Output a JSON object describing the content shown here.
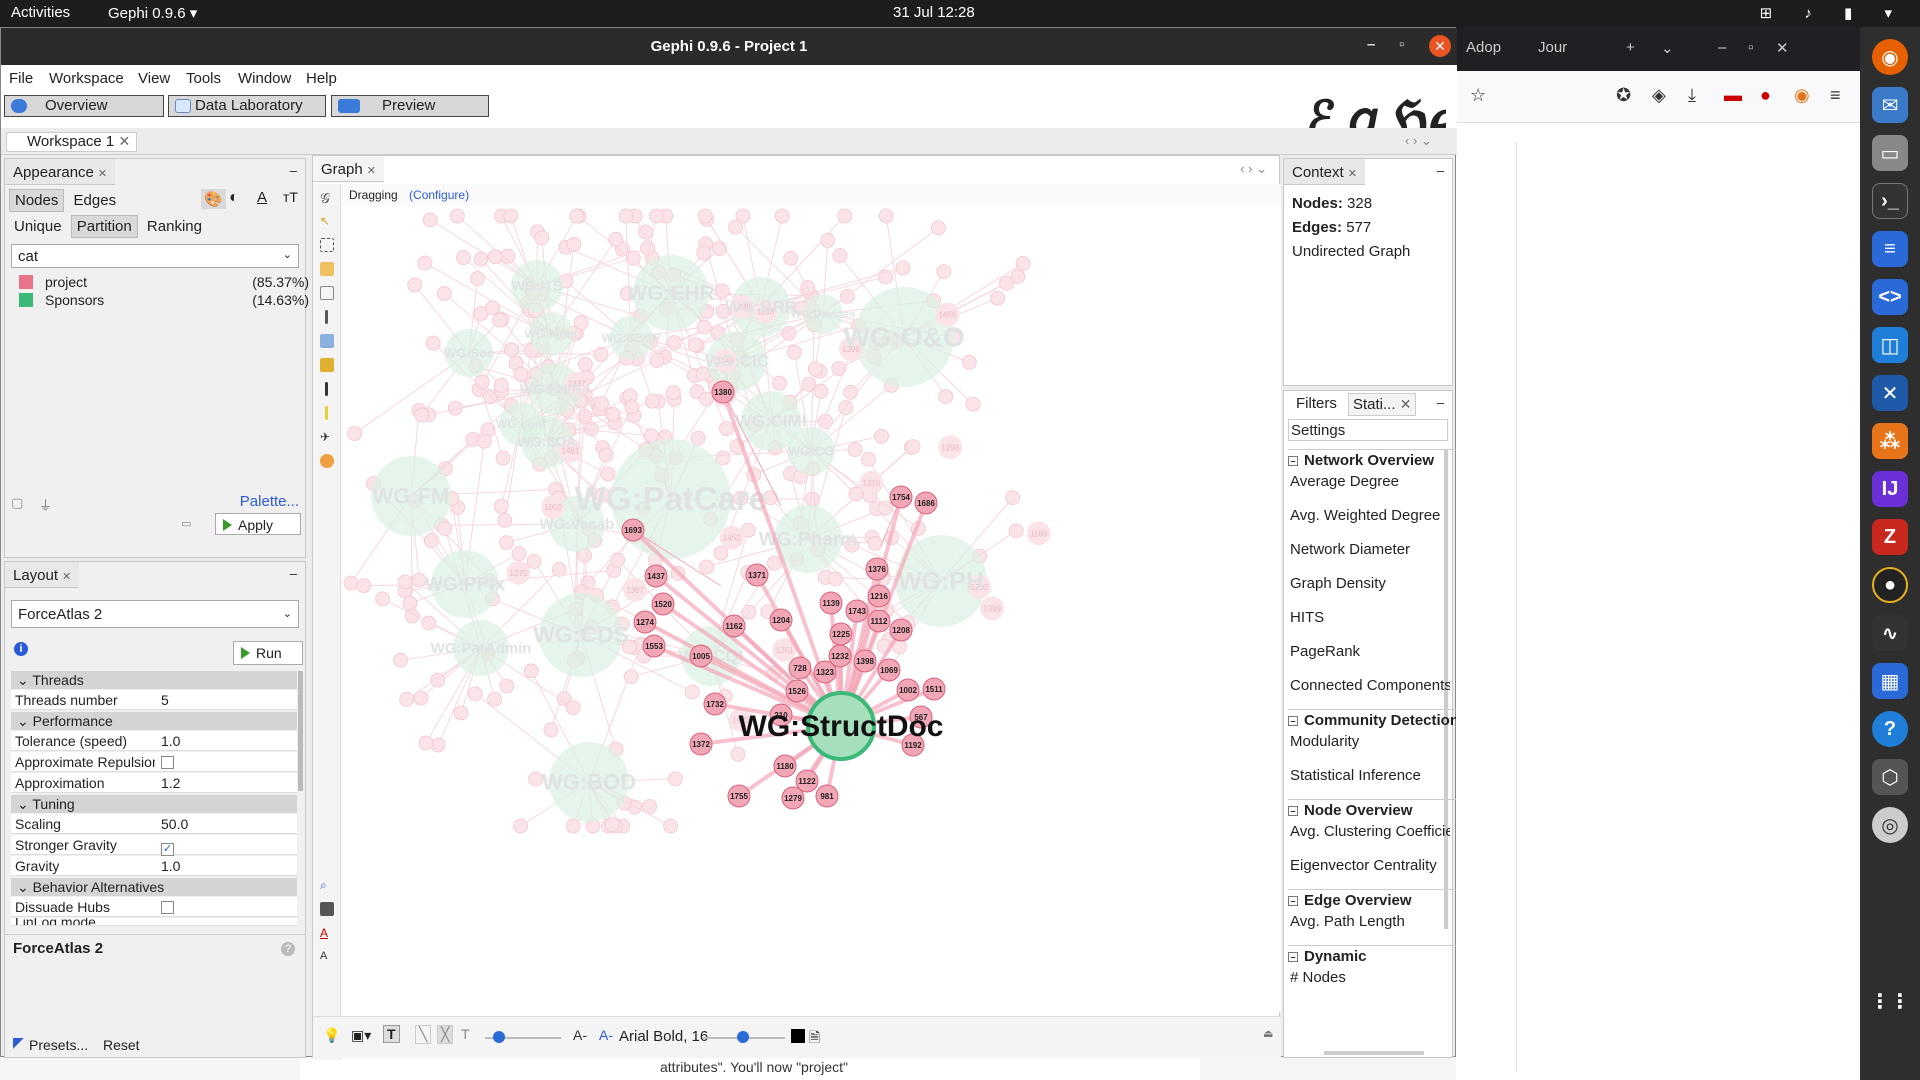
{
  "topbar": {
    "activities": "Activities",
    "app": "Gephi 0.9.6 ▾",
    "clock": "31 Jul  12:28"
  },
  "window": {
    "title": "Gephi 0.9.6 - Project 1"
  },
  "menu": [
    "File",
    "Workspace",
    "View",
    "Tools",
    "Window",
    "Help"
  ],
  "modes": {
    "overview": "Overview",
    "data_lab": "Data Laboratory",
    "preview": "Preview"
  },
  "workspace_tab": "Workspace 1",
  "appearance": {
    "tab": "Appearance",
    "nodes": "Nodes",
    "edges": "Edges",
    "unique": "Unique",
    "partition": "Partition",
    "ranking": "Ranking",
    "attribute": "cat",
    "legend": [
      {
        "label": "project",
        "pct": "(85.37%)",
        "color": "#e8748a"
      },
      {
        "label": "Sponsors",
        "pct": "(14.63%)",
        "color": "#3cb878"
      }
    ],
    "palette": "Palette...",
    "apply": "Apply"
  },
  "layout": {
    "tab": "Layout",
    "algorithm": "ForceAtlas 2",
    "run": "Run",
    "groups": {
      "threads": "Threads",
      "performance": "Performance",
      "tuning": "Tuning",
      "behavior": "Behavior Alternatives"
    },
    "props": {
      "threads_number": {
        "k": "Threads number",
        "v": "5"
      },
      "tolerance": {
        "k": "Tolerance (speed)",
        "v": "1.0"
      },
      "approx_repulsion": {
        "k": "Approximate Repulsion"
      },
      "approximation": {
        "k": "Approximation",
        "v": "1.2"
      },
      "scaling": {
        "k": "Scaling",
        "v": "50.0"
      },
      "stronger_gravity": {
        "k": "Stronger Gravity",
        "checked": true
      },
      "gravity": {
        "k": "Gravity",
        "v": "1.0"
      },
      "dissuade_hubs": {
        "k": "Dissuade Hubs"
      },
      "linlog": {
        "k": "LinLog mode"
      }
    },
    "footer_title": "ForceAtlas 2",
    "presets": "Presets...",
    "reset": "Reset"
  },
  "graph": {
    "tab": "Graph",
    "mode": "Dragging",
    "configure": "(Configure)",
    "font_label": "Arial Bold, 16",
    "big_labels": [
      {
        "t": "WG:PatCare"
      },
      {
        "t": "WG:O&O"
      },
      {
        "t": "WG:PH"
      },
      {
        "t": "WG:Pharm"
      },
      {
        "t": "WG:EHR"
      },
      {
        "t": "WG:FM"
      },
      {
        "t": "WG:PPIx"
      },
      {
        "t": "WG:CDS"
      },
      {
        "t": "WG:BOD"
      },
      {
        "t": "WG:BRR"
      },
      {
        "t": "WG:CIC"
      },
      {
        "t": "WG:CIMI"
      },
      {
        "t": "WG:ITS"
      },
      {
        "t": "WG:SOA"
      },
      {
        "t": "WG:FHIR-I"
      },
      {
        "t": "WG:Soc"
      },
      {
        "t": "WG:Vocab"
      },
      {
        "t": "WG:CQI"
      },
      {
        "t": "WG:PatAdmin"
      },
      {
        "t": "WG:CG"
      },
      {
        "t": "WG:Mnm"
      },
      {
        "t": "WG:CBCP"
      },
      {
        "t": "WG:Devices"
      },
      {
        "t": "WG:conf"
      }
    ],
    "hub_label": "WG:StructDoc",
    "highlight_nodes": [
      "1380",
      "1693",
      "1437",
      "1371",
      "1520",
      "1274",
      "1553",
      "1005",
      "1162",
      "1204",
      "1139",
      "1743",
      "1376",
      "1216",
      "1112",
      "1225",
      "1208",
      "1232",
      "1398",
      "1069",
      "1323",
      "728",
      "1526",
      "1002",
      "1511",
      "1754",
      "1686",
      "1732",
      "1372",
      "210",
      "567",
      "1192",
      "1180",
      "1122",
      "1755",
      "1279",
      "981"
    ],
    "faint_nodes": [
      "1481",
      "1316",
      "1420",
      "1452",
      "1390",
      "1337",
      "1293",
      "1188",
      "1050",
      "1133",
      "1261",
      "1410",
      "1275",
      "1340",
      "1456",
      "1399",
      "1202",
      "1155",
      "1367",
      "1288"
    ]
  },
  "context": {
    "tab": "Context",
    "nodes_label": "Nodes:",
    "nodes": "328",
    "edges_label": "Edges:",
    "edges": "577",
    "type": "Undirected Graph"
  },
  "stats": {
    "filters_tab": "Filters",
    "stats_tab": "Stati...",
    "settings": "Settings",
    "sections": {
      "network": {
        "title": "Network Overview",
        "items": [
          "Average Degree",
          "Avg. Weighted Degree",
          "Network Diameter",
          "Graph Density",
          "HITS",
          "PageRank",
          "Connected Components"
        ]
      },
      "community": {
        "title": "Community Detection",
        "items": [
          "Modularity",
          "Statistical Inference"
        ]
      },
      "node": {
        "title": "Node Overview",
        "items": [
          "Avg. Clustering Coefficient",
          "Eigenvector Centrality"
        ]
      },
      "edge": {
        "title": "Edge Overview",
        "items": [
          "Avg. Path Length"
        ]
      },
      "dynamic": {
        "title": "Dynamic",
        "items": [
          "# Nodes"
        ]
      }
    }
  },
  "firefox": {
    "tab1": "Adop",
    "tab2": "Jour"
  },
  "bgdoc": {
    "text": "attributes\".   You'll   now   \"project\""
  }
}
